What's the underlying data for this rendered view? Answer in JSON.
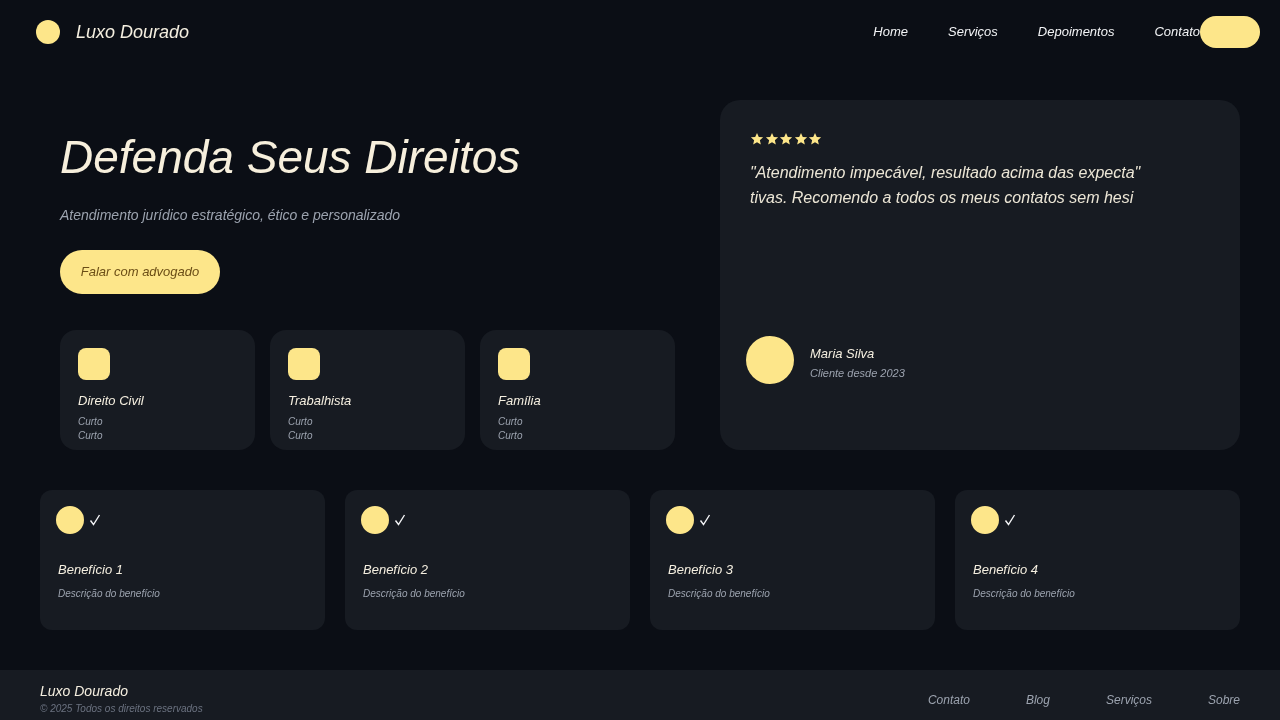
{
  "nav": {
    "brand": "Luxo Dourado",
    "links": [
      "Home",
      "Serviços",
      "Depoimentos",
      "Contato"
    ]
  },
  "hero": {
    "title": "Defenda Seus Direitos",
    "subtitle": "Atendimento jurídico estratégico, ético e personalizado",
    "cta": "Falar com advogado"
  },
  "services": [
    {
      "title": "Direito Civil",
      "lines": [
        "Curto",
        "Curto"
      ]
    },
    {
      "title": "Trabalhista",
      "lines": [
        "Curto",
        "Curto"
      ]
    },
    {
      "title": "Família",
      "lines": [
        "Curto",
        "Curto"
      ]
    }
  ],
  "testimonial": {
    "stars": 5,
    "quote": "\"Atendimento impecável, resultado acima das expecta\"\ntivas. Recomendo a todos os meus contatos sem hesi",
    "author": "Maria Silva",
    "since": "Cliente desde 2023"
  },
  "benefits": [
    {
      "title": "Benefício 1",
      "description": "Descrição do benefício"
    },
    {
      "title": "Benefício 2",
      "description": "Descrição do benefício"
    },
    {
      "title": "Benefício 3",
      "description": "Descrição do benefício"
    },
    {
      "title": "Benefício 4",
      "description": "Descrição do benefício"
    }
  ],
  "footer": {
    "brand": "Luxo Dourado",
    "copyright": "© 2025 Todos os direitos reservados",
    "links": [
      "Contato",
      "Blog",
      "Serviços",
      "Sobre"
    ]
  }
}
